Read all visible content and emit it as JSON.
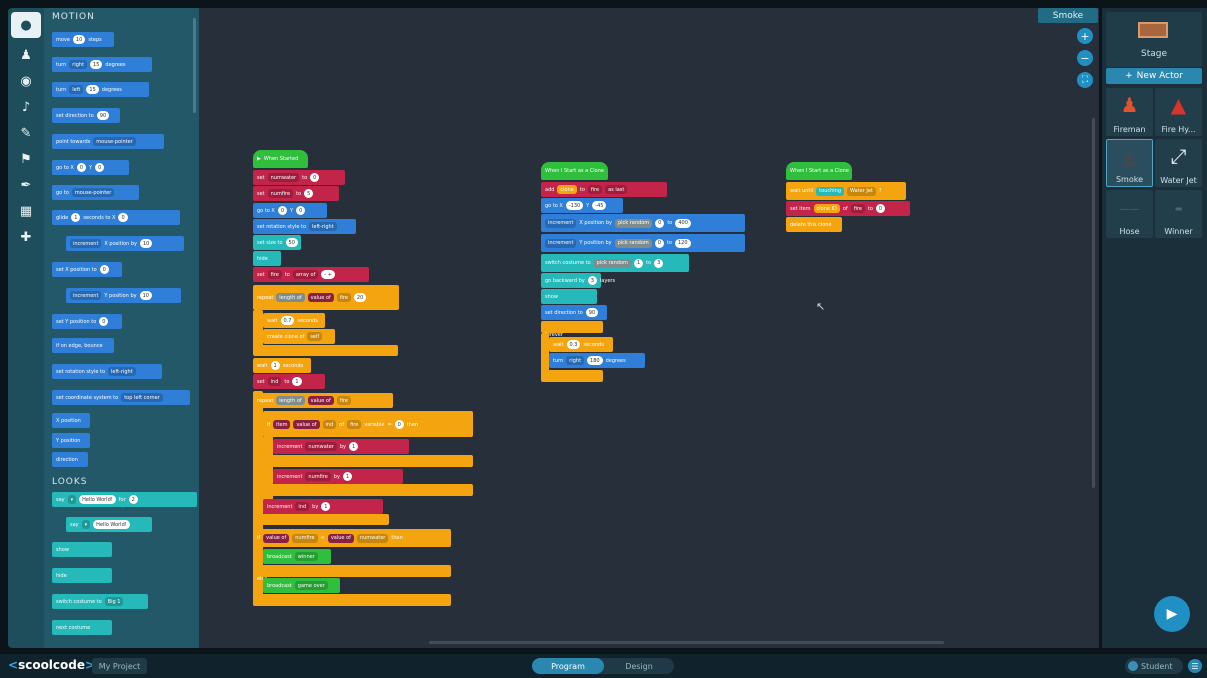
{
  "app": {
    "brand": "scoolcode",
    "brand_open": "<",
    "brand_close": ">",
    "project_name": "My Project"
  },
  "rail_icons": [
    "palette-icon",
    "actor-icon",
    "eye-icon",
    "music-icon",
    "pen-icon",
    "event-icon",
    "pencil-icon",
    "storage-icon",
    "plus-icon"
  ],
  "palette": {
    "motion_header": "MOTION",
    "looks_header": "LOOKS",
    "motion_blocks": [
      {
        "text": "move",
        "pill": "10",
        "after": "steps"
      },
      {
        "text": "turn",
        "dd": "right",
        "pill": "15",
        "after": "degrees"
      },
      {
        "text": "turn",
        "dd": "left",
        "pill": "15",
        "after": "degrees"
      },
      {
        "text": "set direction to",
        "pill": "90",
        "after": ""
      },
      {
        "text": "point towards",
        "dd": "mouse-pointer",
        "after": ""
      },
      {
        "text": "go to X",
        "pill": "0",
        "after": "Y",
        "pill2": "0"
      },
      {
        "text": "go to",
        "dd": "mouse-pointer",
        "after": ""
      },
      {
        "text": "glide",
        "pill": "1",
        "after": "seconds to X",
        "pill2": "0"
      },
      {
        "text": "",
        "dd": "increment",
        "after": "X position by",
        "pill2": "10"
      },
      {
        "text": "set X position to",
        "pill": "0",
        "after": ""
      },
      {
        "text": "",
        "dd": "increment",
        "after": "Y position by",
        "pill2": "10"
      },
      {
        "text": "set Y position to",
        "pill": "0",
        "after": ""
      },
      {
        "text": "if on edge, bounce",
        "after": ""
      },
      {
        "text": "set rotation style to",
        "dd": "left-right",
        "after": ""
      },
      {
        "text": "set coordinate system to",
        "dd": "top left corner",
        "after": ""
      },
      {
        "text": "X position",
        "after": ""
      },
      {
        "text": "Y position",
        "after": ""
      },
      {
        "text": "direction",
        "after": ""
      }
    ],
    "looks_blocks": [
      {
        "text": "say",
        "dd": "",
        "pill": "Hello World!",
        "after": "for",
        "pill2": "2"
      },
      {
        "text": "say",
        "dd": "",
        "pill": "Hello World!",
        "after": ""
      },
      {
        "text": "show",
        "after": ""
      },
      {
        "text": "hide",
        "after": ""
      },
      {
        "text": "switch costume to",
        "dd": "Big 1",
        "after": ""
      },
      {
        "text": "next costume",
        "after": ""
      }
    ]
  },
  "script1": {
    "hat": "When Started",
    "lines": [
      "set",
      "numwater",
      "to",
      "0",
      "set",
      "numfire",
      "to",
      "5",
      "go to X",
      "0",
      "Y",
      "0",
      "set rotation style to",
      "left-right",
      "set size to",
      "50",
      "hide",
      "set",
      "fire",
      "to",
      "array of",
      "repeat",
      "length of",
      "value of",
      "fire",
      "wait",
      "0.7",
      "seconds",
      "create clone of",
      "self",
      "wait",
      "1",
      "seconds",
      "set",
      "ind",
      "to",
      "1",
      "repeat",
      "length of",
      "value of",
      "fire",
      "if",
      "item",
      "value of",
      "ind",
      "of",
      "fire",
      "variable",
      "=",
      "0",
      "then",
      "increment",
      "numwater",
      "by",
      "1",
      "increment",
      "numfire",
      "by",
      "1",
      "increment",
      "ind",
      "by",
      "1",
      "if",
      "value of",
      "numfire",
      "<",
      "value of",
      "numwater",
      "then",
      "broadcast",
      "winner",
      "else",
      "broadcast",
      "game over"
    ]
  },
  "script2": {
    "hat": "When I Start as a Clone",
    "lines": [
      "add",
      "clone",
      "to",
      "fire",
      "as last",
      "go to X",
      "-130",
      "Y",
      "-45",
      "increment",
      "X position by",
      "pick random",
      "0",
      "to",
      "400",
      "increment",
      "Y position by",
      "pick random",
      "0",
      "to",
      "120",
      "switch costume to",
      "pick random",
      "1",
      "to",
      "3",
      "go backward by",
      "3",
      "layers",
      "show",
      "set direction to",
      "90",
      "forever",
      "wait",
      "0.3",
      "seconds",
      "turn",
      "right",
      "180",
      "degrees"
    ]
  },
  "script3": {
    "hat": "When I Start as a Clone",
    "lines": [
      "wait until",
      "touching",
      "Water Jet",
      "?",
      "set item",
      "clone ID",
      "of",
      "fire",
      "to",
      "0",
      "delete this clone"
    ]
  },
  "workspace": {
    "sprite_tag": "Smoke"
  },
  "right_panel": {
    "stage_label": "Stage",
    "new_actor": "New Actor",
    "actors": [
      "Fireman",
      "Fire Hy...",
      "Smoke",
      "Water Jet",
      "Hose",
      "Winner"
    ],
    "selected": "Smoke"
  },
  "bottom": {
    "mode_program": "Program",
    "mode_design": "Design",
    "user": "Student"
  },
  "colors": {
    "control": "#f4a40f",
    "motion": "#2f7fd8",
    "looks": "#26b9b9",
    "data": "#c2244a",
    "events": "#2fbf3d"
  }
}
